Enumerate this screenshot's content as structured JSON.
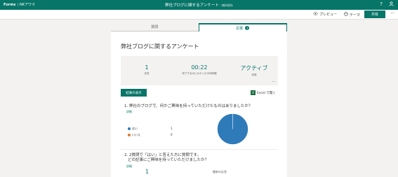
{
  "topbar": {
    "app": "Forms",
    "user": "NKアワマ",
    "title": "弊社ブログに関するアンケート",
    "title_tag": "・無料保存"
  },
  "cmdbar": {
    "preview_label": "プレビュー",
    "theme_label": "テーマ",
    "share_label": "共有"
  },
  "tabs": [
    {
      "label": "質問"
    },
    {
      "label": "応答",
      "count": "1"
    }
  ],
  "form": {
    "title": "弊社ブログに関するアンケート",
    "stats": [
      {
        "value": "1",
        "label": "応答"
      },
      {
        "value": "00:22",
        "label": "完了するのにかかった平均時間"
      },
      {
        "value": "アクティブ",
        "label": "状態"
      }
    ],
    "view_results_label": "結果の表示",
    "open_in_excel_label": "Excel で開く"
  },
  "questions": [
    {
      "title": "1. 弊社のブログで、何かご興味を持っていただけたものはありましたか？",
      "details_label": "詳細",
      "options": [
        {
          "label": "はい",
          "count": "1",
          "color": "#2f7ab9"
        },
        {
          "label": "いいえ",
          "count": "0",
          "color": "#e07a2b"
        }
      ]
    },
    {
      "title_line1": "2. 2質問で「はい」と答えた方に質問です。",
      "title_line2": "どの記事にご興味を持っていただけましたか？",
      "details_label": "詳細",
      "response_count": "1",
      "response_label": "最新の応答"
    }
  ],
  "chart_data": {
    "type": "pie",
    "categories": [
      "はい",
      "いいえ"
    ],
    "values": [
      1,
      0
    ],
    "colors": [
      "#2f7ab9",
      "#e07a2b"
    ]
  }
}
